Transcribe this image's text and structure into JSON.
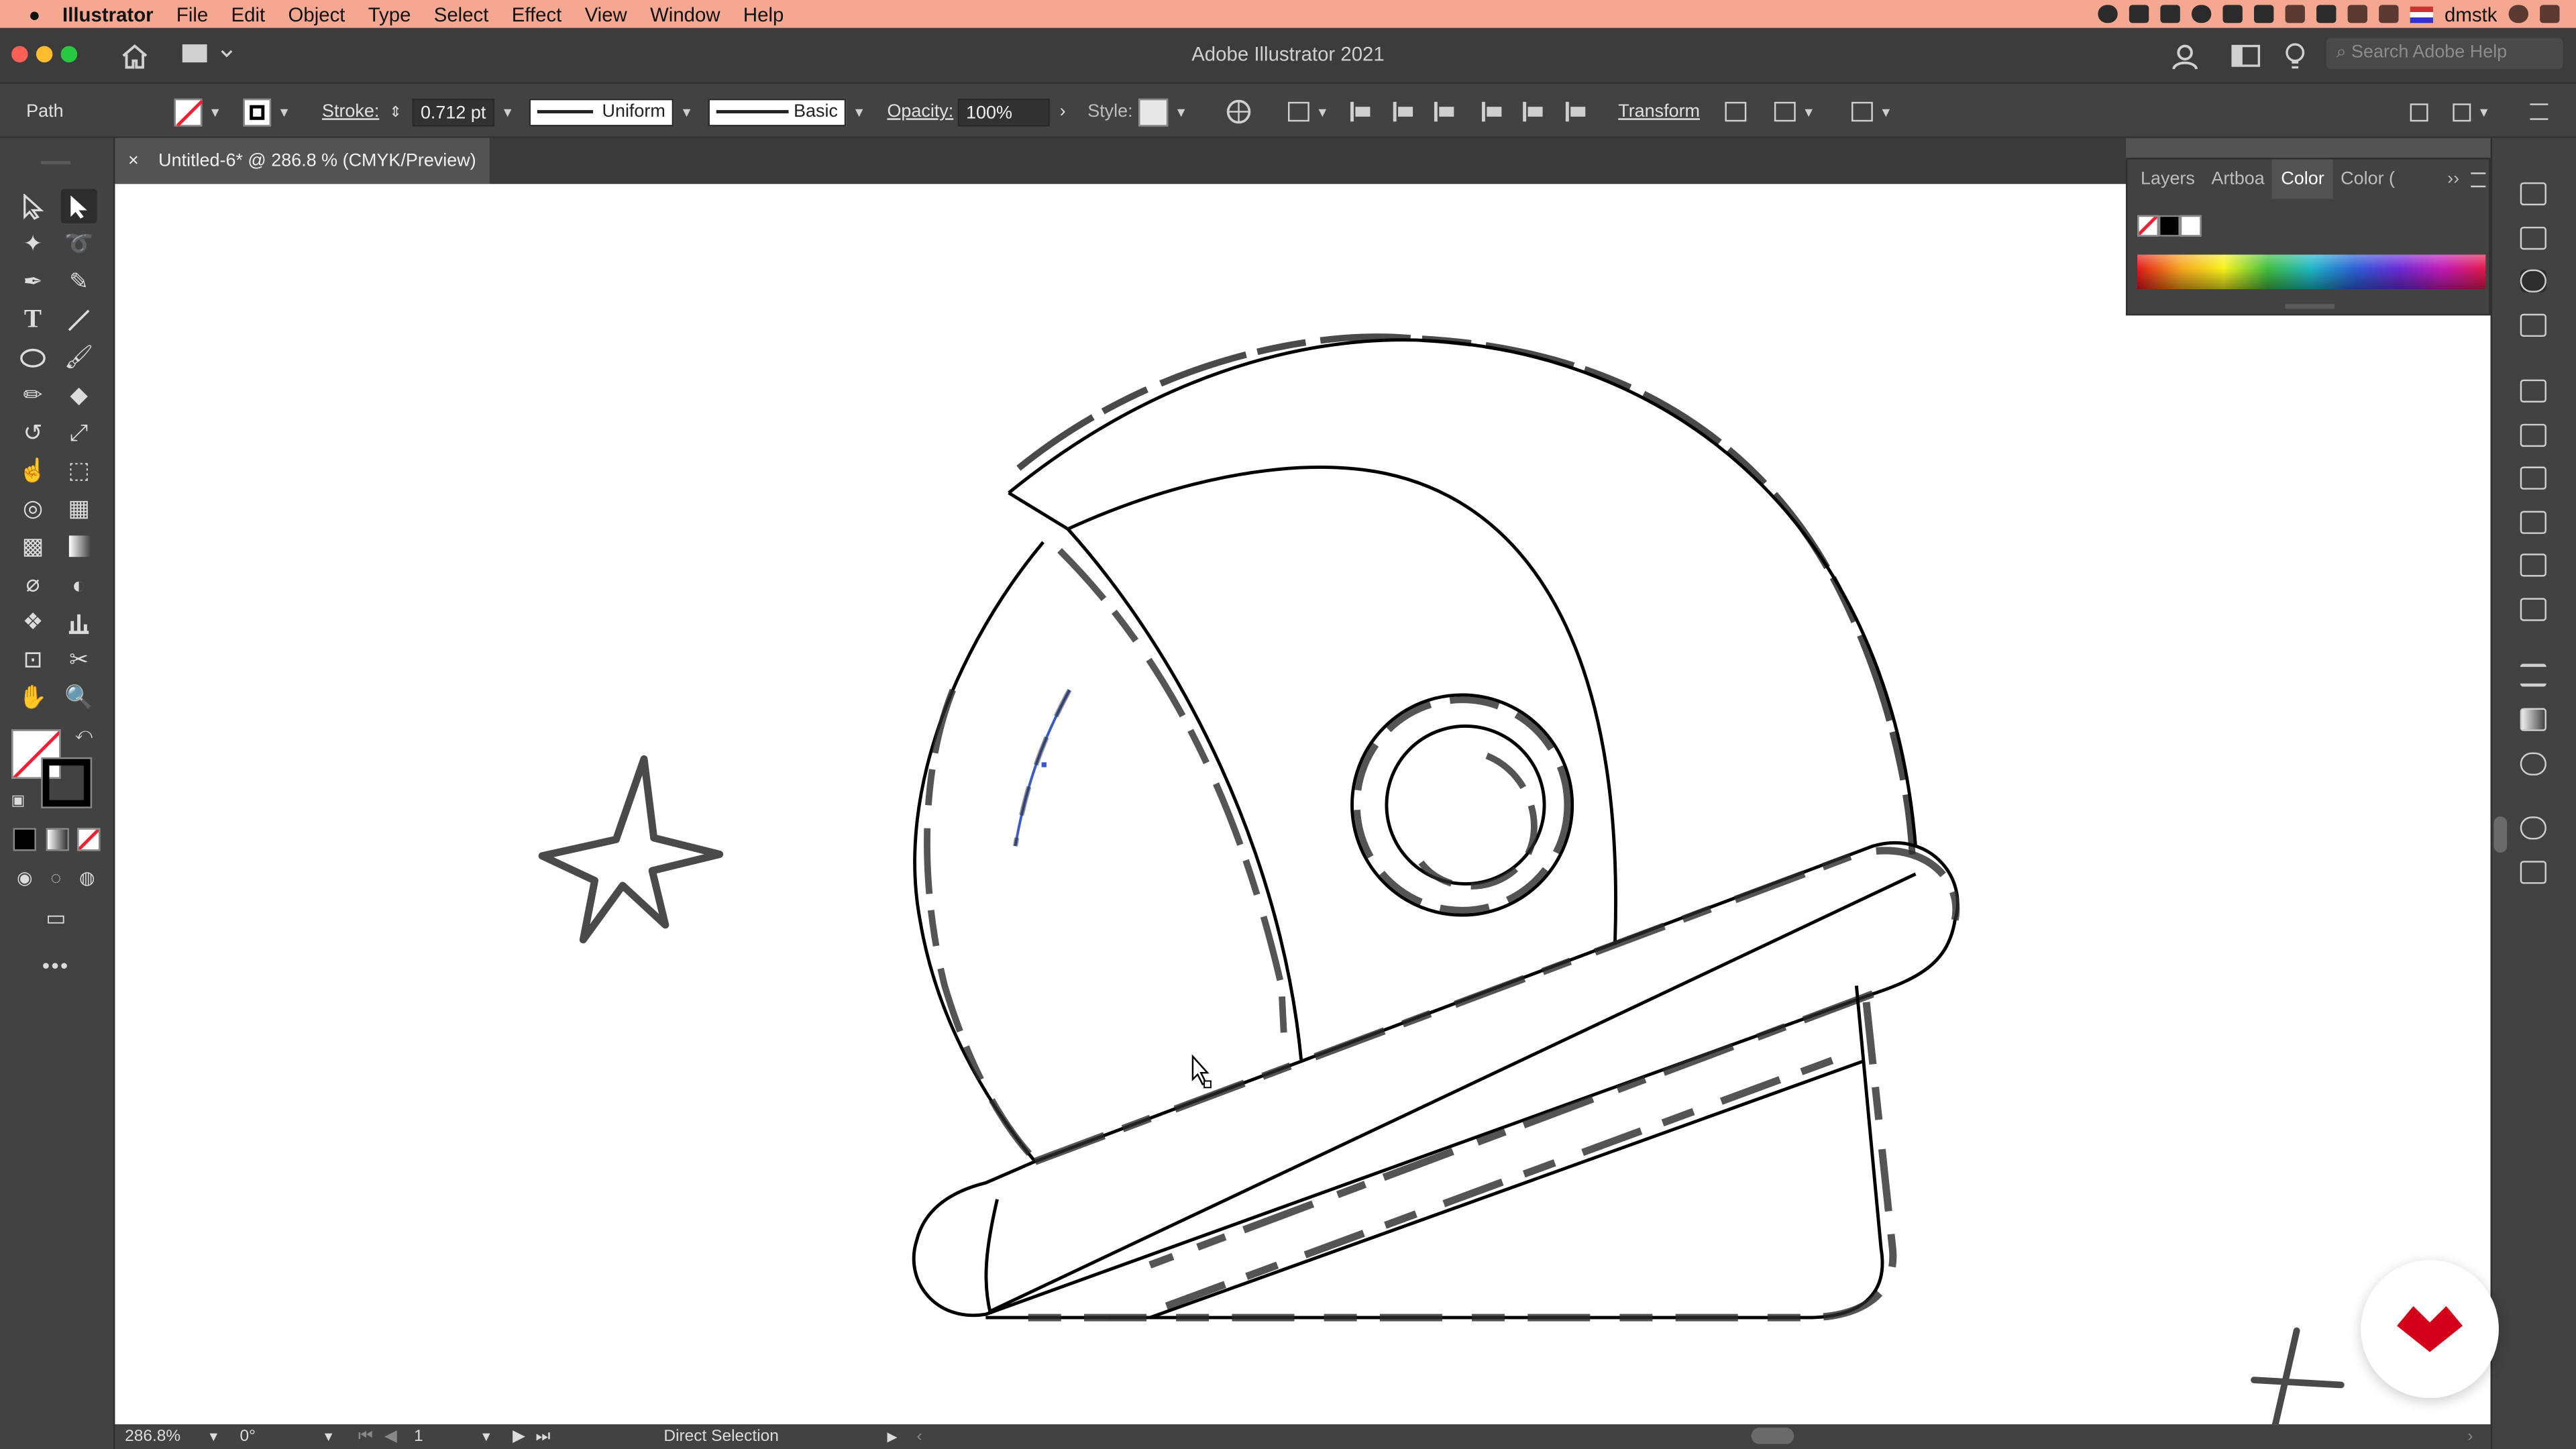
{
  "menubar": {
    "app_name": "Illustrator",
    "items": [
      "File",
      "Edit",
      "Object",
      "Type",
      "Select",
      "Effect",
      "View",
      "Window",
      "Help"
    ],
    "user": "dmstk"
  },
  "appbar": {
    "title": "Adobe Illustrator 2021",
    "search_placeholder": "Search Adobe Help"
  },
  "controlbar": {
    "selection_type": "Path",
    "stroke_label": "Stroke:",
    "stroke_value": "0.712 pt",
    "stroke_profile": "Uniform",
    "brush": "Basic",
    "opacity_label": "Opacity:",
    "opacity_value": "100%",
    "style_label": "Style:",
    "transform_label": "Transform"
  },
  "document_tab": {
    "close": "×",
    "title": "Untitled-6* @ 286.8 % (CMYK/Preview)"
  },
  "color_panel": {
    "tabs": [
      "Layers",
      "Artboa",
      "Color",
      "Color ("
    ],
    "active_tab": "Color"
  },
  "statusbar": {
    "zoom": "286.8%",
    "rotation": "0°",
    "artboard": "1",
    "tool": "Direct Selection"
  },
  "colors": {
    "menubar_bg": "#f4a892",
    "ui_dark": "#424242",
    "canvas": "#ffffff",
    "accent_red": "#d4001a"
  },
  "icons": {
    "tools": [
      "selection-tool",
      "direct-selection-tool",
      "magic-wand-tool",
      "lasso-tool",
      "pen-tool",
      "curvature-tool",
      "type-tool",
      "line-tool",
      "ellipse-tool",
      "paintbrush-tool",
      "pencil-tool",
      "eraser-tool",
      "rotate-tool",
      "scale-tool",
      "warp-tool",
      "free-transform-tool",
      "shape-builder-tool",
      "perspective-grid-tool",
      "mesh-tool",
      "gradient-tool",
      "eyedropper-tool",
      "blend-tool",
      "symbol-sprayer-tool",
      "column-graph-tool",
      "artboard-tool",
      "slice-tool",
      "hand-tool",
      "zoom-tool"
    ]
  }
}
